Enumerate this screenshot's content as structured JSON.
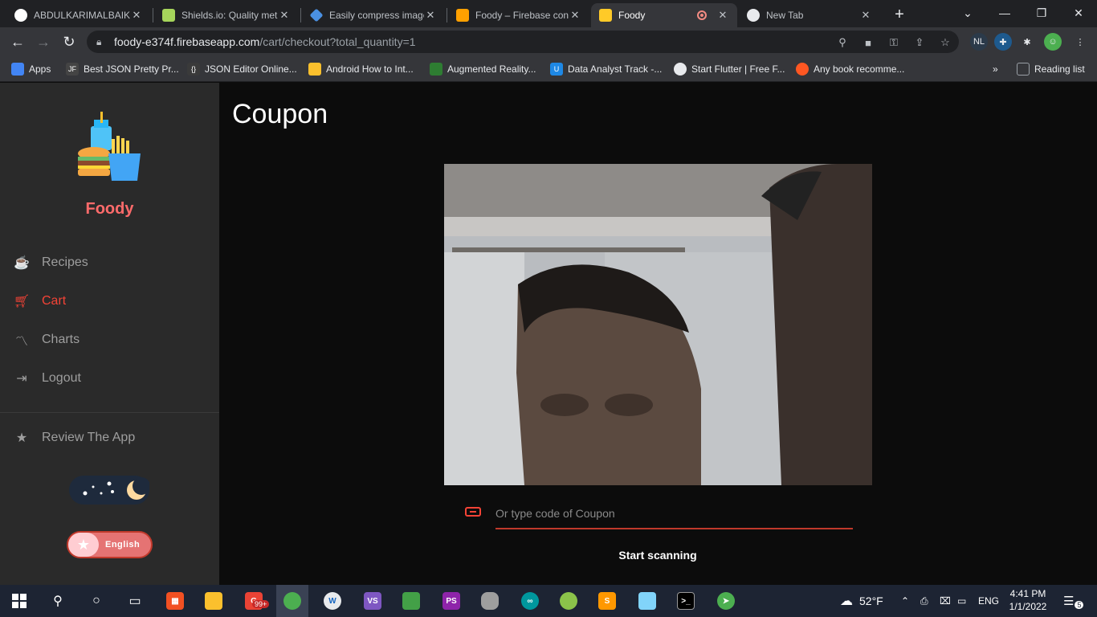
{
  "browser": {
    "tabs": [
      {
        "title": "ABDULKARIMALBAIK/",
        "favicon_color": "#ffffff"
      },
      {
        "title": "Shields.io: Quality met",
        "favicon_color": "#a6d55b"
      },
      {
        "title": "Easily compress image",
        "favicon_color": "#4a90e2"
      },
      {
        "title": "Foody – Firebase cons",
        "favicon_color": "#ffa000"
      },
      {
        "title": "Foody",
        "favicon_color": "#ffca28"
      },
      {
        "title": "New Tab",
        "favicon_color": "#e8eaed"
      }
    ],
    "url_host": "foody-e374f.firebaseapp.com",
    "url_path": "/cart/checkout?total_quantity=1",
    "bookmarks": [
      {
        "label": "Apps",
        "color": "#4285f4"
      },
      {
        "label": "Best JSON Pretty Pr...",
        "color": "#444444"
      },
      {
        "label": "JSON Editor Online...",
        "color": "#3a3a3a"
      },
      {
        "label": "Android How to Int...",
        "color": "#fbc02d"
      },
      {
        "label": "Augmented Reality...",
        "color": "#2e7d32"
      },
      {
        "label": "Data Analyst Track -...",
        "color": "#1e88e5"
      },
      {
        "label": "Start Flutter | Free F...",
        "color": "#e8eaed"
      },
      {
        "label": "Any book recomme...",
        "color": "#ff5722"
      },
      {
        "label": "Reading list",
        "color": "#9aa0a6"
      }
    ],
    "bookmarks_overflow": "»"
  },
  "sidebar": {
    "brand": "Foody",
    "items": [
      {
        "label": "Recipes",
        "icon": "recipes-icon",
        "active": false
      },
      {
        "label": "Cart",
        "icon": "cart-icon",
        "active": true
      },
      {
        "label": "Charts",
        "icon": "charts-icon",
        "active": false
      },
      {
        "label": "Logout",
        "icon": "logout-icon",
        "active": false
      }
    ],
    "review_label": "Review The App",
    "language_label": "English"
  },
  "main": {
    "title": "Coupon",
    "coupon_placeholder": "Or type code of Coupon",
    "scan_label": "Start scanning"
  },
  "taskbar": {
    "notification_badge": "99+",
    "weather": "52°F",
    "language": "ENG",
    "time": "4:41 PM",
    "date": "1/1/2022",
    "action_center_count": "5"
  },
  "colors": {
    "accent": "#f44336",
    "sidebar_bg": "#2a2a2a",
    "main_bg": "#0c0c0c"
  }
}
